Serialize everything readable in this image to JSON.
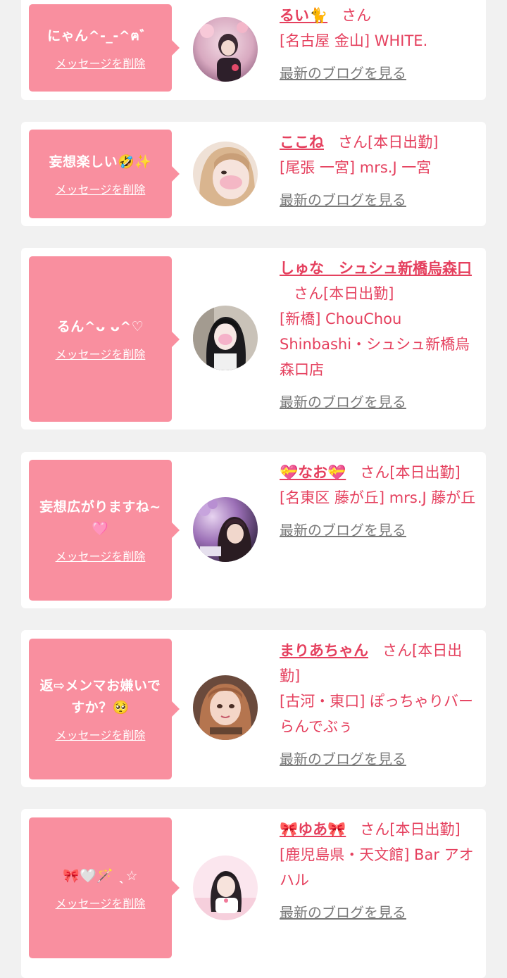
{
  "delete_label": "メッセージを削除",
  "blog_label": "最新のブログを見る",
  "colors": {
    "background": "#f1f1f1",
    "bubble": "#f98f9f",
    "accent": "#e5405e",
    "muted": "#7a7a7a"
  },
  "items": [
    {
      "message": "にゃん^-_-^ฅ゛",
      "name": "るい🐈",
      "suffix": "さん",
      "shop": "[名古屋 金山] WHITE."
    },
    {
      "message": "妄想楽しい🤣✨",
      "name": "ここね",
      "suffix": "さん[本日出勤]",
      "shop": "[尾張 一宮] mrs.J 一宮"
    },
    {
      "message": "るん^ᴗ ᴗ^♡",
      "name": "しゅな　シュシュ新橋烏森口",
      "suffix": "さん[本日出勤]",
      "shop": "[新橋] ChouChou Shinbashi・シュシュ新橋烏森口店"
    },
    {
      "message": "妄想広がりますね~🩷",
      "name": "💝なお💝",
      "suffix": "さん[本日出勤]",
      "shop": "[名東区 藤が丘] mrs.J 藤が丘"
    },
    {
      "message": "返⇨メンマお嫌いですか？🥺",
      "name": "まりあちゃん",
      "suffix": "さん[本日出勤]",
      "shop": "[古河・東口] ぽっちゃりバー らんでぶぅ"
    },
    {
      "message": "🎀🤍🪄 ˎ☆",
      "name": "🎀ゆあ🎀",
      "suffix": "さん[本日出勤]",
      "shop": "[鹿児島県・天文館] Bar アオハル"
    }
  ]
}
